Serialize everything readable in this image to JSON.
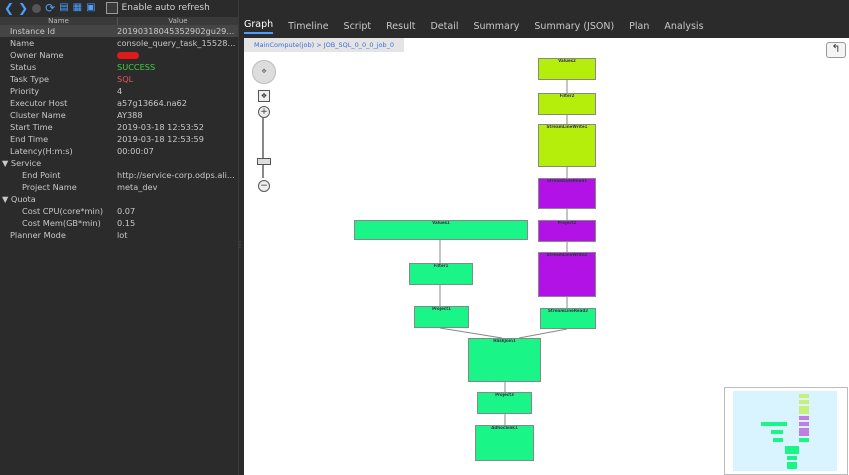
{
  "toolbar": {
    "back_icon": "chevron-left-icon",
    "forward_icon": "chevron-right-icon",
    "auto_refresh_label": "Enable auto refresh"
  },
  "table": {
    "headers": {
      "name": "Name",
      "value": "Value"
    },
    "rows": [
      {
        "name": "Instance Id",
        "value": "20190318045352902gu29..."
      },
      {
        "name": "Name",
        "value": "console_query_task_15528..."
      },
      {
        "name": "Owner Name",
        "value": ""
      },
      {
        "name": "Status",
        "value": "SUCCESS"
      },
      {
        "name": "Task Type",
        "value": "SQL"
      },
      {
        "name": "Priority",
        "value": "4"
      },
      {
        "name": "Executor Host",
        "value": "a57g13664.na62"
      },
      {
        "name": "Cluster Name",
        "value": "AY388"
      },
      {
        "name": "Start Time",
        "value": "2019-03-18 12:53:52"
      },
      {
        "name": "End Time",
        "value": "2019-03-18 12:53:59"
      },
      {
        "name": "Latency(H:m:s)",
        "value": "00:00:07"
      }
    ],
    "service": {
      "label": "Service",
      "rows": [
        {
          "name": "End Point",
          "value": "http://service-corp.odps.ali..."
        },
        {
          "name": "Project Name",
          "value": "meta_dev"
        }
      ]
    },
    "quota": {
      "label": "Quota",
      "rows": [
        {
          "name": "Cost CPU(core*min)",
          "value": "0.07"
        },
        {
          "name": "Cost Mem(GB*min)",
          "value": "0.15"
        }
      ]
    },
    "planner": {
      "name": "Planner Mode",
      "value": "lot"
    }
  },
  "tabs": [
    "Graph",
    "Timeline",
    "Script",
    "Result",
    "Detail",
    "Summary",
    "Summary (JSON)",
    "Plan",
    "Analysis"
  ],
  "active_tab": "Graph",
  "graph": {
    "breadcrumb": "MainCompute(job) > JOB_SQL_0_0_0_job_0",
    "nodes": [
      {
        "id": "n1",
        "title": "Values2",
        "color": "#b6ee0c"
      },
      {
        "id": "n2",
        "title": "Filter2",
        "color": "#b6ee0c"
      },
      {
        "id": "n3",
        "title": "StreamLineWrite1",
        "color": "#b6ee0c"
      },
      {
        "id": "n4",
        "title": "StreamLineRead1",
        "color": "#b312e6"
      },
      {
        "id": "n5",
        "title": "Project2",
        "color": "#b312e6"
      },
      {
        "id": "n6",
        "title": "StreamLineWrite2",
        "color": "#b312e6"
      },
      {
        "id": "n7",
        "title": "Values1",
        "color": "#19f587"
      },
      {
        "id": "n8",
        "title": "Filter1",
        "color": "#19f587"
      },
      {
        "id": "n9",
        "title": "Project1",
        "color": "#19f587"
      },
      {
        "id": "n10",
        "title": "StreamLineRead2",
        "color": "#19f587"
      },
      {
        "id": "n11",
        "title": "HashJoin1",
        "color": "#19f587"
      },
      {
        "id": "n12",
        "title": "Project3",
        "color": "#19f587"
      },
      {
        "id": "n13",
        "title": "AdhocSink1",
        "color": "#19f587"
      }
    ]
  }
}
